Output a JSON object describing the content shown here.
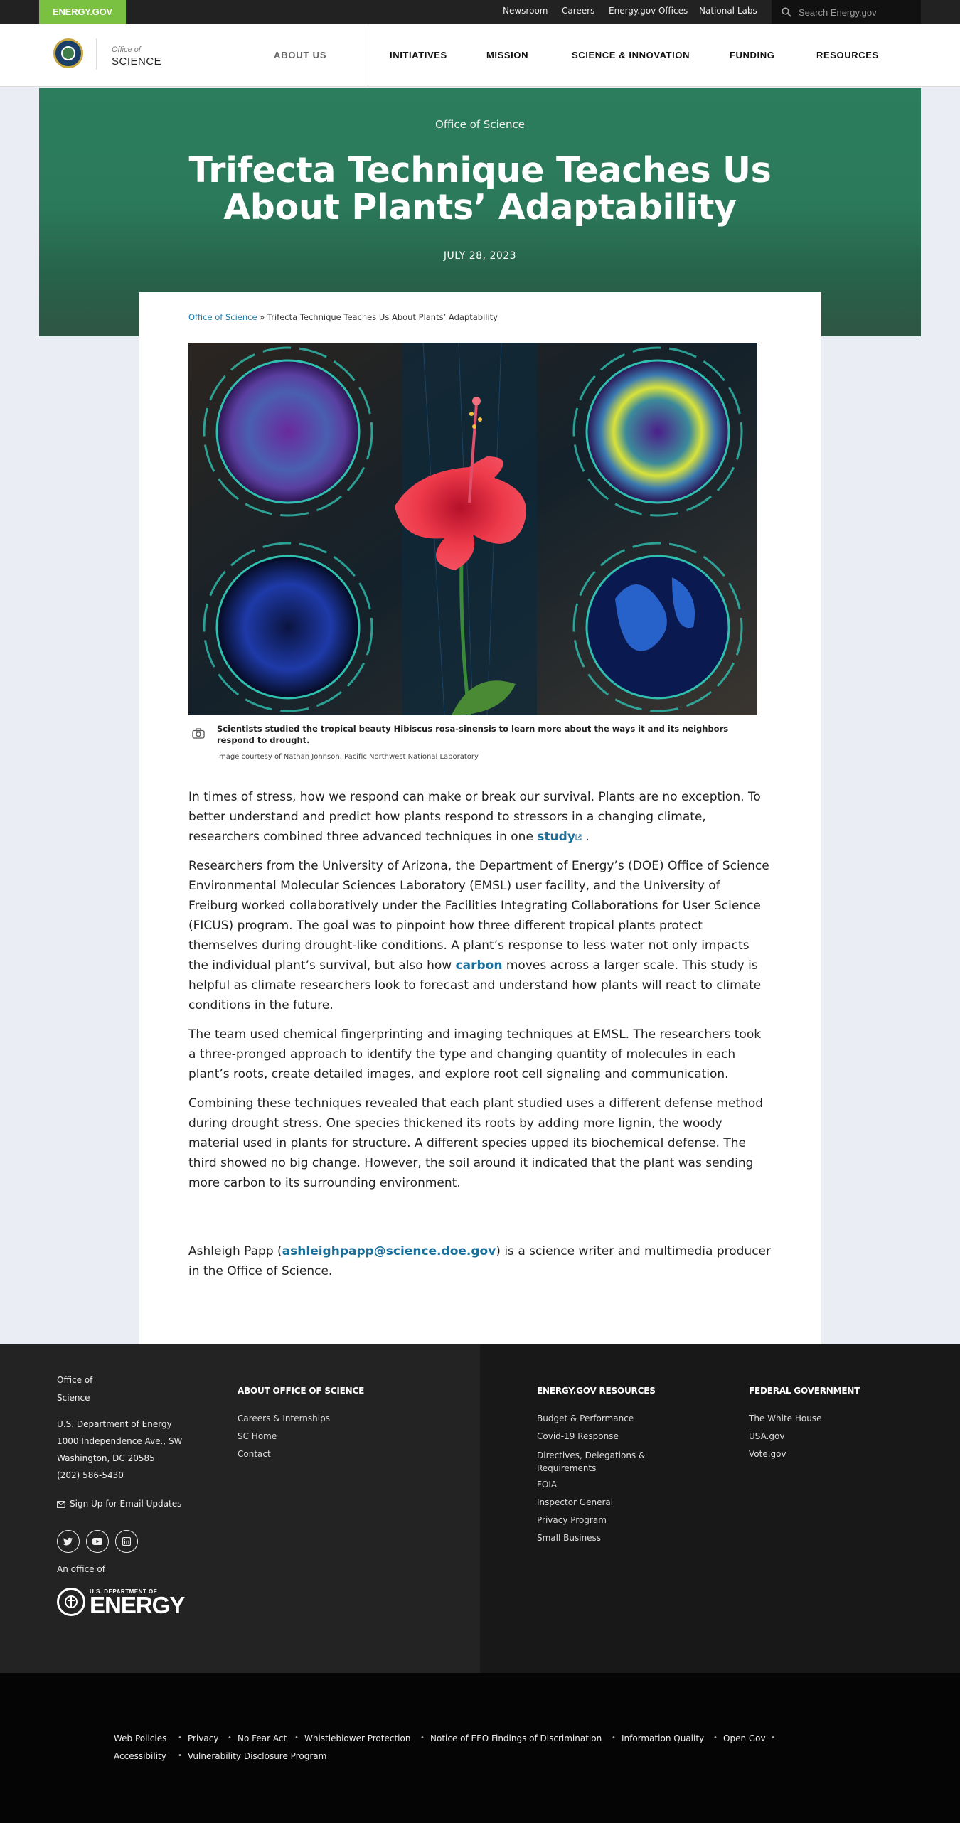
{
  "topbar": {
    "brand": "ENERGY.GOV",
    "links": [
      "Newsroom",
      "Careers",
      "Energy.gov Offices",
      "National Labs"
    ],
    "search_placeholder": "Search Energy.gov"
  },
  "header": {
    "logo_small": "Office of",
    "logo_big": "SCIENCE",
    "about": "ABOUT US",
    "nav": [
      "INITIATIVES",
      "MISSION",
      "SCIENCE & INNOVATION",
      "FUNDING",
      "RESOURCES"
    ]
  },
  "hero": {
    "kicker": "Office of Science",
    "title": "Trifecta Technique Teaches Us About Plants’ Adaptability",
    "date": "JULY 28, 2023"
  },
  "breadcrumb": {
    "link": "Office of Science",
    "separator": "»",
    "current": "Trifecta Technique Teaches Us About Plants’ Adaptability"
  },
  "figure": {
    "caption": "Scientists studied the tropical beauty Hibiscus rosa-sinensis to learn more about the ways it and its neighbors respond to drought.",
    "credit": "Image courtesy of Nathan Johnson, Pacific Northwest National Laboratory"
  },
  "article": {
    "p1_before": "In times of stress, how we respond can make or break our survival. Plants are no exception. To better understand and predict how plants respond to stressors in a changing climate, researchers combined three advanced techniques in one ",
    "p1_link": "study",
    "p1_after": " .",
    "p2_before": "Researchers from the University of Arizona, the Department of Energy’s (DOE) Office of Science Environmental Molecular Sciences Laboratory (EMSL) user facility, and the University of Freiburg worked collaboratively under the Facilities Integrating Collaborations for User Science (FICUS) program. The goal was to pinpoint how three different tropical plants protect themselves during drought-like conditions. A plant’s response to less water not only impacts the individual plant’s survival, but also how ",
    "p2_link": "carbon",
    "p2_after": " moves across a larger scale. This study is helpful as climate researchers look to forecast and understand how plants will react to climate conditions in the future.",
    "p3": "The team used chemical fingerprinting and imaging techniques at EMSL. The researchers took a three-pronged approach to identify the type and changing quantity of molecules in each plant’s roots, create detailed images, and explore root cell signaling and communication.",
    "p4": "Combining these techniques revealed that each plant studied uses a different defense method during drought stress. One species thickened its roots by adding more lignin, the woody material used in plants for structure. A different species upped its biochemical defense. The third showed no big change. However, the soil around it indicated that the plant was sending more carbon to its surrounding environment.",
    "p5_before": "Ashleigh Papp (",
    "p5_link": "ashleighpapp@science.doe.gov",
    "p5_after": ") is a science writer and multimedia producer in the Office of Science."
  },
  "footer": {
    "office_line1": "Office of",
    "office_line2": "Science",
    "address": [
      "U.S. Department of Energy",
      "1000 Independence Ave., SW",
      "Washington, DC 20585",
      "(202) 586-5430"
    ],
    "email_signup": "Sign Up for Email Updates",
    "an_office_of": "An office of",
    "doe_small": "U.S. DEPARTMENT OF",
    "doe_big": "ENERGY",
    "col1": {
      "heading": "ABOUT OFFICE OF SCIENCE",
      "links": [
        "Careers & Internships",
        "SC Home",
        "Contact"
      ]
    },
    "col2": {
      "heading": "ENERGY.GOV RESOURCES",
      "links": [
        "Budget & Performance",
        "Covid-19 Response",
        "Directives, Delegations & Requirements",
        "FOIA",
        "Inspector General",
        "Privacy Program",
        "Small Business"
      ]
    },
    "col3": {
      "heading": "FEDERAL GOVERNMENT",
      "links": [
        "The White House",
        "USA.gov",
        "Vote.gov"
      ]
    }
  },
  "legal": {
    "row1": [
      "Web Policies",
      "Privacy",
      "No Fear Act",
      "Whistleblower Protection",
      "Notice of EEO Findings of Discrimination",
      "Information Quality",
      "Open Gov"
    ],
    "row2": [
      "Accessibility",
      "Vulnerability Disclosure Program"
    ]
  },
  "colors": {
    "brand_green": "#7ac142",
    "hero_green": "#2b7d5d",
    "link_blue": "#1a6f9b"
  }
}
